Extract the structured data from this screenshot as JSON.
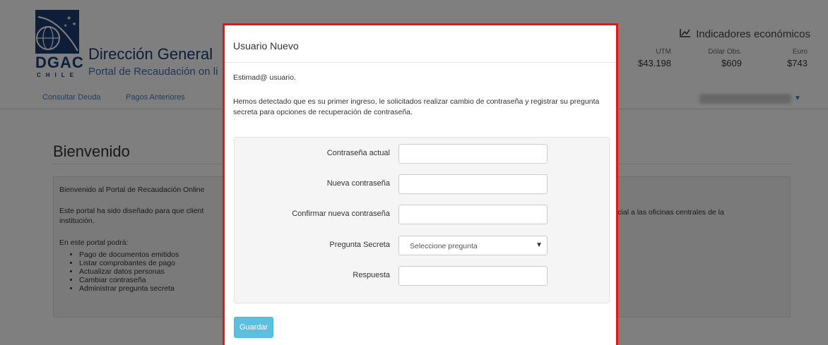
{
  "header": {
    "logo_text": "DGAC",
    "logo_sub": "CHILE",
    "agency_title": "Dirección General",
    "portal_title": "Portal de Recaudación on li"
  },
  "indicators": {
    "title": "Indicadores económicos",
    "icon": "line-chart-icon",
    "items": [
      {
        "label": "UTM",
        "value": "$43.198"
      },
      {
        "label": "Dólar Obs.",
        "value": "$609"
      },
      {
        "label": "Euro",
        "value": "$743"
      }
    ]
  },
  "navbar": {
    "items": [
      {
        "label": "Consultar Deuda"
      },
      {
        "label": "Pagos Anteriores"
      }
    ]
  },
  "welcome": {
    "title": "Bienvenido",
    "intro": "Bienvenido al Portal de Recaudación Online",
    "description_left": "Este portal ha sido diseñado para que client",
    "description_left_2": "institución.",
    "description_right": "resencial a las oficinas centrales de la",
    "list_title": "En este portal podrá:",
    "list": [
      "Pago de documentos emitidos",
      "Listar comprobantes de pago",
      "Actualizar datos personas",
      "Cambiar contraseña",
      "Administrar pregunta secreta"
    ]
  },
  "modal": {
    "title": "Usuario Nuevo",
    "greeting": "Estimad@ usuario.",
    "message": "Hemos detectado que es su primer ingreso, le solicitados realizar cambio de contraseña y registrar su pregunta secreta para opciones de recuperación de contraseña.",
    "fields": {
      "current_password": {
        "label": "Contraseña actual",
        "value": ""
      },
      "new_password": {
        "label": "Nueva contraseña",
        "value": ""
      },
      "confirm_password": {
        "label": "Confirmar nueva contraseña",
        "value": ""
      },
      "secret_question": {
        "label": "Pregunta Secreta",
        "selected": "Seleccione pregunta"
      },
      "answer": {
        "label": "Respuesta",
        "value": ""
      }
    },
    "save_label": "Guardar"
  },
  "colors": {
    "modal_border": "#e2171d",
    "save_button": "#5bc0de",
    "link": "#4a7bbf",
    "brand": "#1d3d73"
  }
}
